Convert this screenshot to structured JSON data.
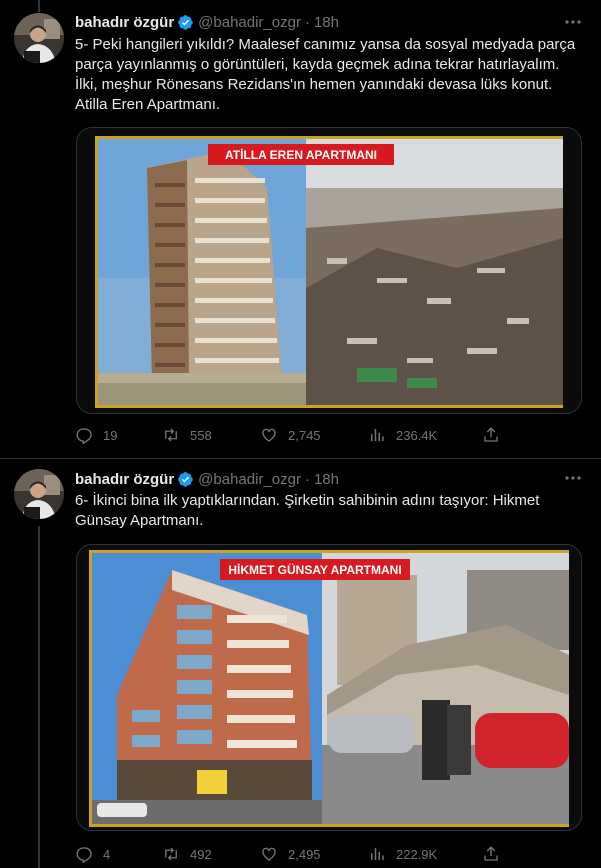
{
  "tweets": [
    {
      "author": "bahadır özgür",
      "handle": "@bahadir_ozgr",
      "separator": "·",
      "time": "18h",
      "text": "5- Peki hangileri yıkıldı? Maalesef canımız yansa da sosyal medyada parça parça yayınlanmış o görüntüleri, kayda geçmek adına tekrar hatırlayalım. İlki, meşhur Rönesans Rezidans'ın hemen yanındaki devasa lüks konut. Atilla Eren Apartmanı.",
      "image_banner": "ATİLLA EREN APARTMANI",
      "replies": "19",
      "retweets": "558",
      "likes": "2,745",
      "views": "236.4K"
    },
    {
      "author": "bahadır özgür",
      "handle": "@bahadir_ozgr",
      "separator": "·",
      "time": "18h",
      "text": "6- İkinci bina ilk yaptıklarından. Şirketin sahibinin adını taşıyor: Hikmet Günsay Apartmanı.",
      "image_banner": "HİKMET GÜNSAY APARTMANI",
      "replies": "4",
      "retweets": "492",
      "likes": "2,495",
      "views": "222.9K"
    }
  ],
  "icons": {
    "verified": "verified-badge-icon",
    "more": "more-icon",
    "reply": "reply-icon",
    "retweet": "retweet-icon",
    "like": "like-icon",
    "views": "views-icon",
    "share": "share-icon"
  },
  "colors": {
    "background": "#000000",
    "text": "#e7e9ea",
    "muted": "#71767b",
    "verified": "#1d9bf0",
    "banner": "#d71920"
  }
}
